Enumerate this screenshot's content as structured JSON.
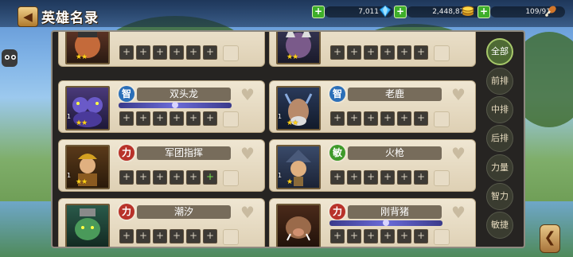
{
  "header": {
    "title": "英雄名录",
    "back_icon": "back-arrow-icon"
  },
  "resources": [
    {
      "value": "7,011",
      "icon": "diamond-icon"
    },
    {
      "value": "2,448,872",
      "icon": "gold-coin-icon"
    },
    {
      "value": "109/91",
      "icon": "drumstick-icon"
    }
  ],
  "filters": [
    "全部",
    "前排",
    "中排",
    "后排",
    "力量",
    "智力",
    "敏捷"
  ],
  "attr_colors": {
    "智": "#2c6fb8",
    "力": "#b8322a",
    "敏": "#3e9a2a"
  },
  "heroes": [
    {
      "name": "",
      "attr": "",
      "stars": "★★",
      "level": "",
      "slots": [
        "+",
        "+",
        "+",
        "+",
        "+",
        "+"
      ]
    },
    {
      "name": "",
      "attr": "",
      "stars": "★★",
      "level": "",
      "slots": [
        "+",
        "+",
        "+",
        "+",
        "+",
        "+"
      ]
    },
    {
      "name": "双头龙",
      "attr": "智",
      "stars": "★★",
      "level": "1",
      "slots": [
        "+",
        "+",
        "+",
        "+",
        "+",
        "+"
      ]
    },
    {
      "name": "老鹿",
      "attr": "智",
      "stars": "★★",
      "level": "1",
      "slots": [
        "+",
        "+",
        "+",
        "+",
        "+",
        "+"
      ]
    },
    {
      "name": "军团指挥",
      "attr": "力",
      "stars": "★★",
      "level": "1",
      "slots": [
        "+",
        "+",
        "+",
        "+",
        "+",
        "+"
      ]
    },
    {
      "name": "火枪",
      "attr": "敏",
      "stars": "★",
      "level": "1",
      "slots": [
        "+",
        "+",
        "+",
        "+",
        "+",
        "+"
      ]
    },
    {
      "name": "潮汐",
      "attr": "力",
      "stars": "",
      "level": "",
      "slots": [
        "+",
        "+",
        "+",
        "+",
        "+",
        "+"
      ]
    },
    {
      "name": "刚背猪",
      "attr": "力",
      "stars": "",
      "level": "",
      "slots": [
        "+",
        "+",
        "+",
        "+",
        "+",
        "+"
      ]
    }
  ]
}
